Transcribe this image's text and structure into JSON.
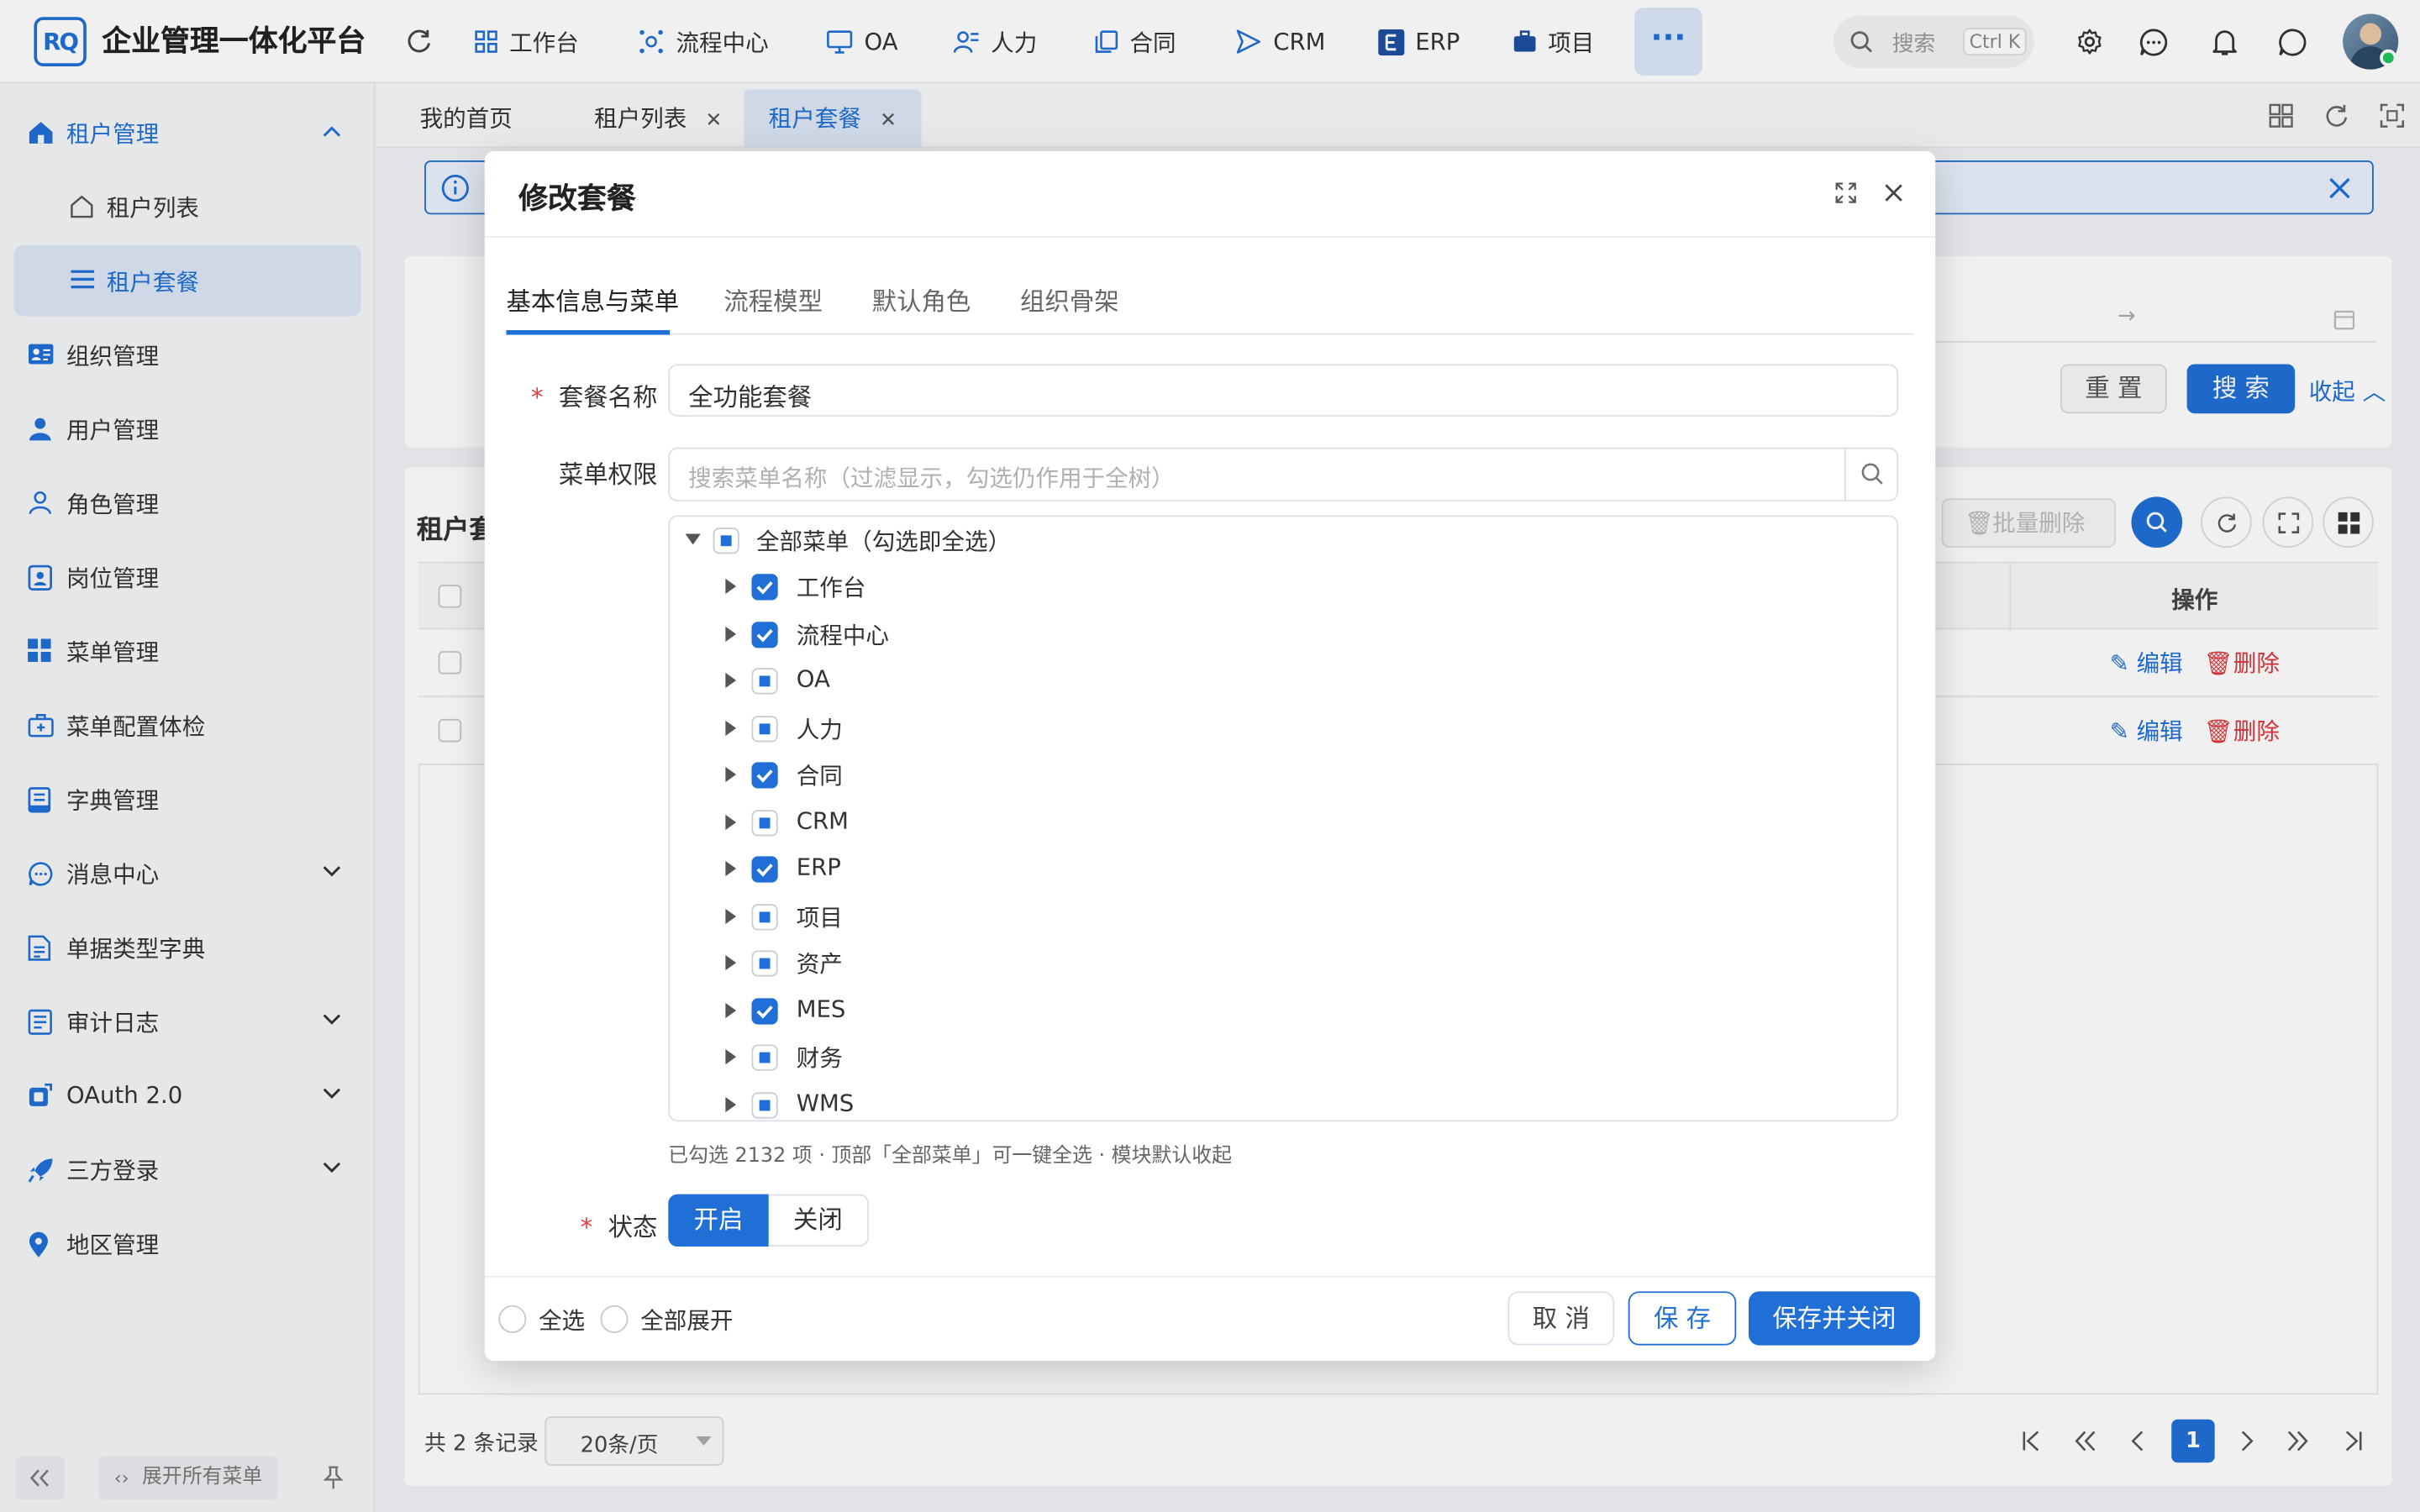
{
  "app": {
    "logo_text": "RQ",
    "title": "企业管理一体化平台"
  },
  "topnav": {
    "items": [
      {
        "label": "工作台",
        "icon": "grid-icon"
      },
      {
        "label": "流程中心",
        "icon": "flow-icon"
      },
      {
        "label": "OA",
        "icon": "monitor-icon"
      },
      {
        "label": "人力",
        "icon": "users-icon"
      },
      {
        "label": "合同",
        "icon": "copy-icon"
      },
      {
        "label": "CRM",
        "icon": "send-icon"
      },
      {
        "label": "ERP",
        "icon": "erp-icon"
      },
      {
        "label": "项目",
        "icon": "briefcase-icon"
      }
    ],
    "more_label": "···",
    "search_placeholder": "搜索",
    "search_shortcut": "Ctrl K"
  },
  "sidebar": {
    "items": [
      {
        "label": "租户管理",
        "icon": "home-icon",
        "expanded": true
      },
      {
        "label": "租户列表",
        "icon": "home-outline-icon"
      },
      {
        "label": "租户套餐",
        "icon": "list-icon",
        "active": true
      },
      {
        "label": "组织管理",
        "icon": "id-card-icon"
      },
      {
        "label": "用户管理",
        "icon": "user-icon"
      },
      {
        "label": "角色管理",
        "icon": "user-outline-icon"
      },
      {
        "label": "岗位管理",
        "icon": "badge-icon"
      },
      {
        "label": "菜单管理",
        "icon": "apps-icon"
      },
      {
        "label": "菜单配置体检",
        "icon": "medkit-icon"
      },
      {
        "label": "字典管理",
        "icon": "book-icon"
      },
      {
        "label": "消息中心",
        "icon": "message-icon"
      },
      {
        "label": "单据类型字典",
        "icon": "doc-icon"
      },
      {
        "label": "审计日志",
        "icon": "log-icon"
      },
      {
        "label": "OAuth 2.0",
        "icon": "oauth-icon"
      },
      {
        "label": "三方登录",
        "icon": "rocket-icon"
      },
      {
        "label": "地区管理",
        "icon": "location-icon"
      }
    ],
    "expand_all_label": "展开所有菜单"
  },
  "pagetabs": [
    {
      "label": "我的首页"
    },
    {
      "label": "租户列表"
    },
    {
      "label": "租户套餐"
    }
  ],
  "background": {
    "reset_label": "重 置",
    "search_label": "搜 索",
    "collapse_label": "收起",
    "table_title": "租户套",
    "batch_delete_label": "批量删除",
    "ops_header": "操作",
    "edit_label": "编辑",
    "delete_label": "删除",
    "total_label": "共 2 条记录",
    "page_size": "20条/页",
    "current_page": "1"
  },
  "modal": {
    "title": "修改套餐",
    "tabs": [
      "基本信息与菜单",
      "流程模型",
      "默认角色",
      "组织骨架"
    ],
    "name_label": "套餐名称",
    "name_value": "全功能套餐",
    "menu_label": "菜单权限",
    "menu_search_placeholder": "搜索菜单名称（过滤显示，勾选仍作用于全树）",
    "tree_root": "全部菜单（勾选即全选）",
    "tree_items": [
      {
        "label": "工作台",
        "state": "checked"
      },
      {
        "label": "流程中心",
        "state": "checked"
      },
      {
        "label": "OA",
        "state": "partial"
      },
      {
        "label": "人力",
        "state": "partial"
      },
      {
        "label": "合同",
        "state": "checked"
      },
      {
        "label": "CRM",
        "state": "partial"
      },
      {
        "label": "ERP",
        "state": "checked"
      },
      {
        "label": "项目",
        "state": "partial"
      },
      {
        "label": "资产",
        "state": "partial"
      },
      {
        "label": "MES",
        "state": "checked"
      },
      {
        "label": "财务",
        "state": "partial"
      },
      {
        "label": "WMS",
        "state": "partial"
      }
    ],
    "hint": "已勾选 2132 项 · 顶部「全部菜单」可一键全选 · 模块默认收起",
    "status_label": "状态",
    "status_on": "开启",
    "status_off": "关闭",
    "select_all_label": "全选",
    "expand_all_label": "全部展开",
    "cancel_label": "取 消",
    "save_label": "保 存",
    "save_close_label": "保存并关闭"
  },
  "colors": {
    "primary": "#1f6fd6",
    "danger": "#e0353b"
  }
}
